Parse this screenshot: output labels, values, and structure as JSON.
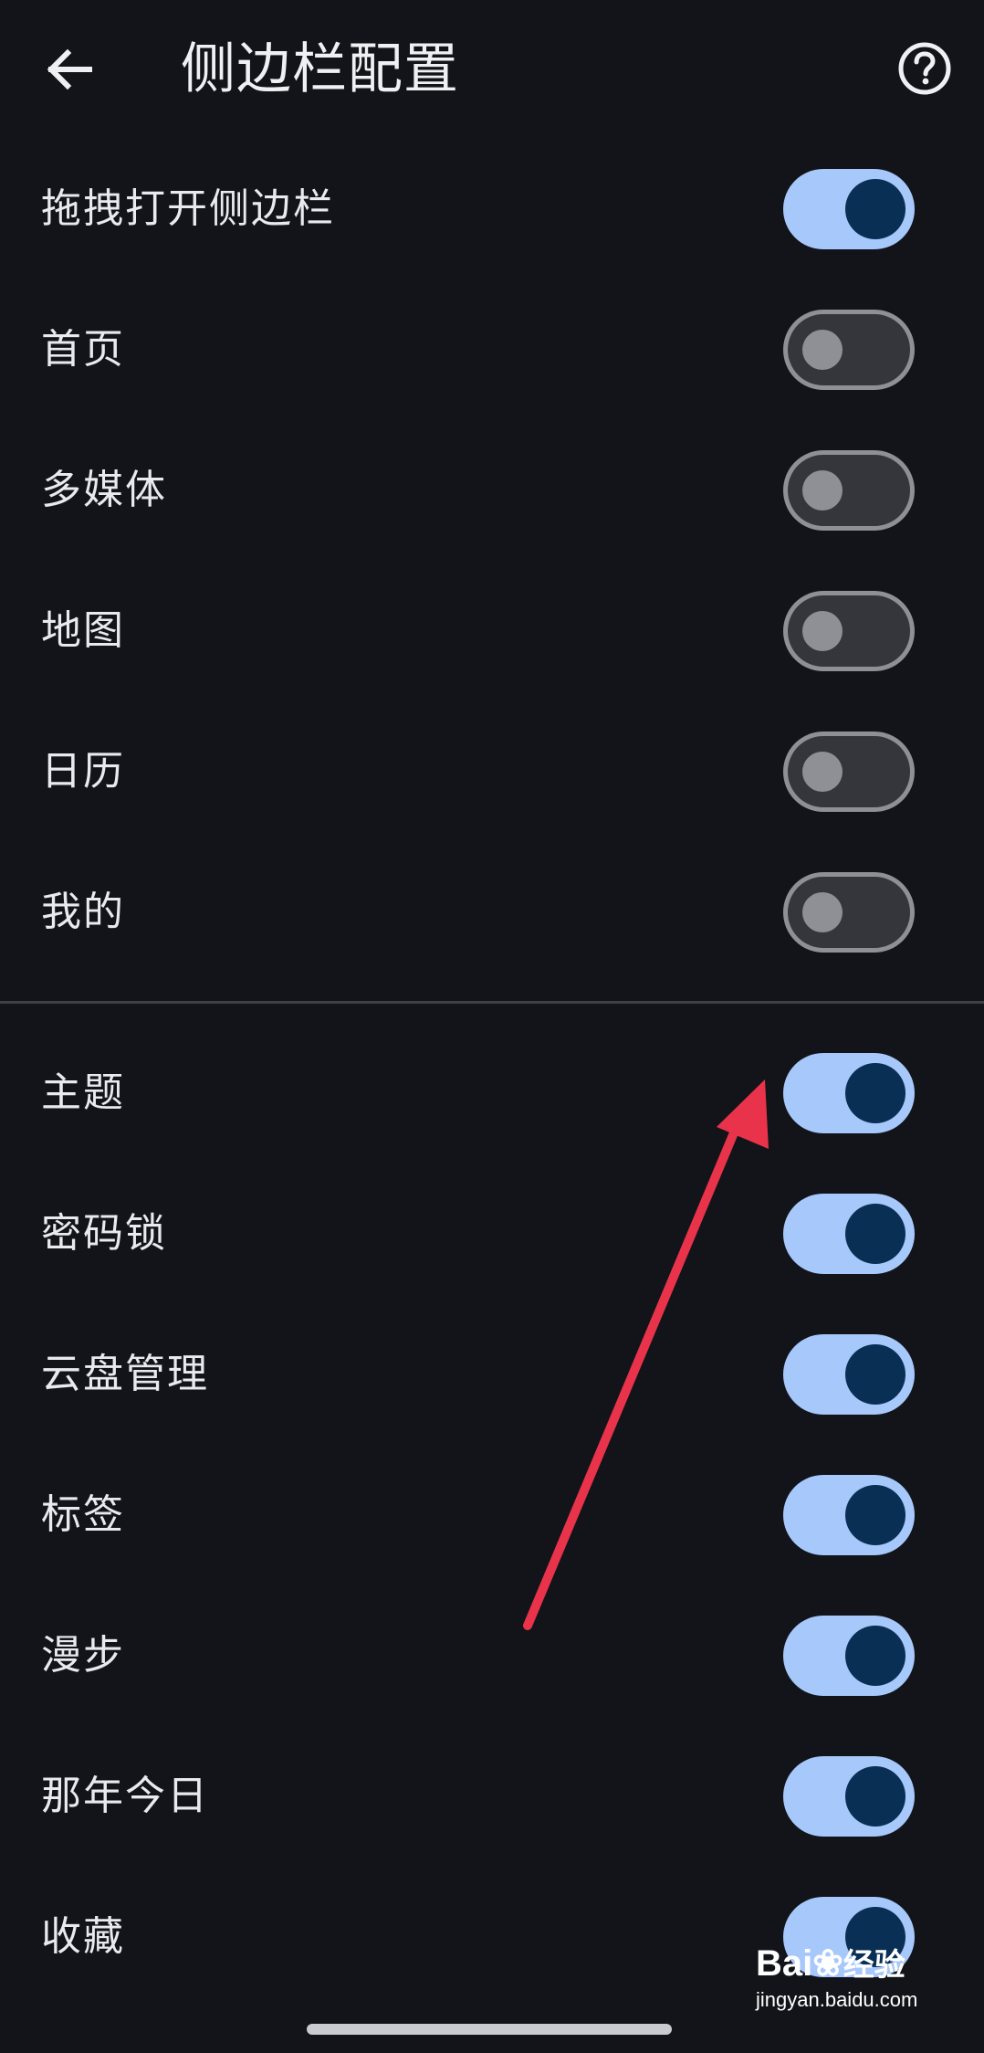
{
  "header": {
    "back_icon": "arrow-left-icon",
    "title": "侧边栏配置",
    "help_icon": "question-circle-icon"
  },
  "group1": {
    "items": [
      {
        "label": "拖拽打开侧边栏",
        "enabled": true
      },
      {
        "label": "首页",
        "enabled": false
      },
      {
        "label": "多媒体",
        "enabled": false
      },
      {
        "label": "地图",
        "enabled": false
      },
      {
        "label": "日历",
        "enabled": false
      },
      {
        "label": "我的",
        "enabled": false
      }
    ]
  },
  "group2": {
    "items": [
      {
        "label": "主题",
        "enabled": true
      },
      {
        "label": "密码锁",
        "enabled": true
      },
      {
        "label": "云盘管理",
        "enabled": true
      },
      {
        "label": "标签",
        "enabled": true
      },
      {
        "label": "漫步",
        "enabled": true
      },
      {
        "label": "那年今日",
        "enabled": true
      },
      {
        "label": "收藏",
        "enabled": true
      }
    ]
  },
  "annotation": {
    "arrow_color": "#e8334a",
    "arrow_icon": "red-arrow-annotation"
  },
  "watermark": {
    "brand": "Bai",
    "brand_suffix": "经验",
    "url": "jingyan.baidu.com"
  },
  "colors": {
    "background": "#121419",
    "toggle_on_track": "#a7c8fb",
    "toggle_on_thumb": "#0a2f55",
    "toggle_off_track": "#34363b",
    "toggle_off_border": "#8e9096"
  }
}
